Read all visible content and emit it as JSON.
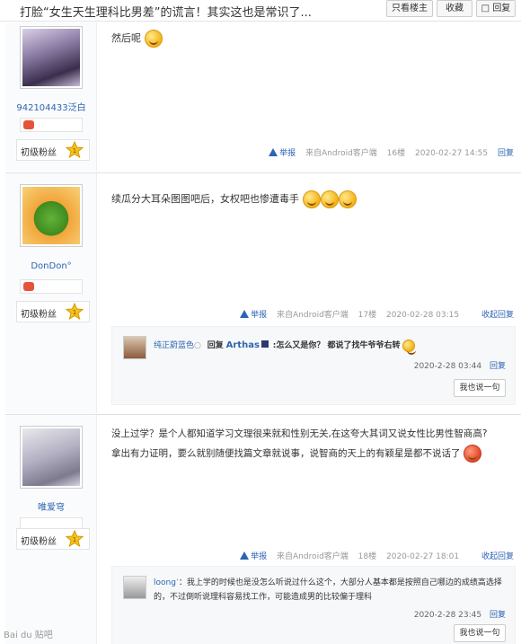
{
  "header": {
    "title": "打脸“女生天生理科比男差”的谎言！其实这也是常识了...",
    "btn_only_owner": "只看楼主",
    "btn_collect": "收藏",
    "btn_reply": "回复"
  },
  "posts": [
    {
      "username": "942104433泛白",
      "fan_level": "初级粉丝",
      "content": "然后呢",
      "report": "举报",
      "client": "来自Android客户端",
      "floor": "16楼",
      "time": "2020-02-27 14:55",
      "reply": "回复"
    },
    {
      "username": "DonDon°",
      "fan_level": "初级粉丝",
      "content": "续瓜分大耳朵图图吧后，女权吧也惨遭毒手",
      "report": "举报",
      "client": "来自Android客户端",
      "floor": "17楼",
      "time": "2020-02-28 03:15",
      "reply": "收起回复",
      "sub_replies": [
        {
          "name": "纯正蔚蓝色",
          "text_pre": ":",
          "reply_word": "回复",
          "reply_to": "Arthas",
          "text": ":怎么又是你？ 都说了找牛爷爷右转",
          "time": "2020-2-28 03:44",
          "reply": "回复"
        }
      ],
      "say_button": "我也说一句"
    },
    {
      "username": "唯爱穹",
      "fan_level": "初级粉丝",
      "content_line1": "没上过学？是个人都知道学习文理很来就和性别无关,在这夸大其词又说女性比男性智商高?",
      "content_line2": "拿出有力证明，要么就别随便找篇文章就说事，说智商的天上的有颖星是都不说话了",
      "report": "举报",
      "client": "来自Android客户端",
      "floor": "18楼",
      "time": "2020-02-27 18:01",
      "reply": "收起回复",
      "sub_replies": [
        {
          "name": "loong",
          "text": "：我上学的时候也是没怎么听说过什么这个，大部分人基本都是按照自己哪边的成绩高选择的，不过倒听说理科容易找工作，可能造成男的比较偏于理科",
          "time": "2020-2-28 23:45",
          "reply": "回复"
        }
      ],
      "say_button": "我也说一句"
    }
  ],
  "watermark": "Bai du 贴吧"
}
